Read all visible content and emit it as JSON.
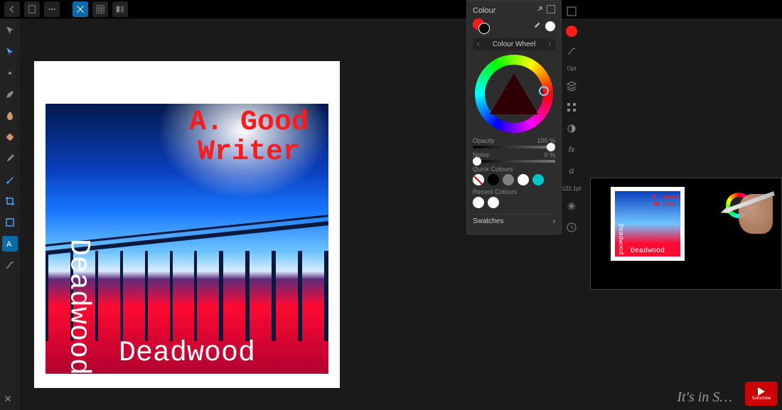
{
  "topbar": {
    "back": "←",
    "doc": "▦",
    "more": "⋯"
  },
  "tools": [
    {
      "name": "move-tool",
      "glyph": "arrow"
    },
    {
      "name": "node-tool",
      "glyph": "node"
    },
    {
      "name": "dot-tool",
      "glyph": "dot"
    },
    {
      "name": "pen-tool",
      "glyph": "pen"
    },
    {
      "name": "burn-tool",
      "glyph": "burn"
    },
    {
      "name": "healing-tool",
      "glyph": "heal"
    },
    {
      "name": "eyedropper-tool",
      "glyph": "eye"
    },
    {
      "name": "brush-tool",
      "glyph": "brush"
    },
    {
      "name": "crop-tool",
      "glyph": "crop"
    },
    {
      "name": "shape-tool",
      "glyph": "rect"
    },
    {
      "name": "art-text-tool",
      "glyph": "textA",
      "active": true
    },
    {
      "name": "vector-brush-tool",
      "glyph": "curve"
    }
  ],
  "artwork": {
    "author": "A. Good\nWriter",
    "title_bottom": "Deadwood",
    "title_side": "Deadwood"
  },
  "colour_panel": {
    "title": "Colour",
    "mode": "Colour Wheel",
    "opacity_label": "Opacity",
    "opacity_value": "100 %",
    "opacity_pct": 100,
    "noise_label": "Noise",
    "noise_value": "0 %",
    "noise_pct": 0,
    "quick_label": "Quick Colours",
    "quick_colours": [
      "nofill",
      "#000000",
      "#808080",
      "#ffffff",
      "#00c8c8"
    ],
    "recent_label": "Recent Colours",
    "recent_colours": [
      "#ffffff",
      "#ffffff"
    ],
    "swatches_label": "Swatches",
    "primary": "#ff1a1a",
    "secondary": "#000000",
    "tool_primary": "#ffffff"
  },
  "right_strip": {
    "brush_size": "122.1pt",
    "label": "Opt",
    "fx": "fx",
    "italic": "a"
  },
  "pip": {
    "author": "A. Good\nWriter",
    "title_bottom": "Deadwood",
    "title_side": "Deadwood"
  },
  "subscribe": "Subscribe",
  "signature": "It's in S…"
}
